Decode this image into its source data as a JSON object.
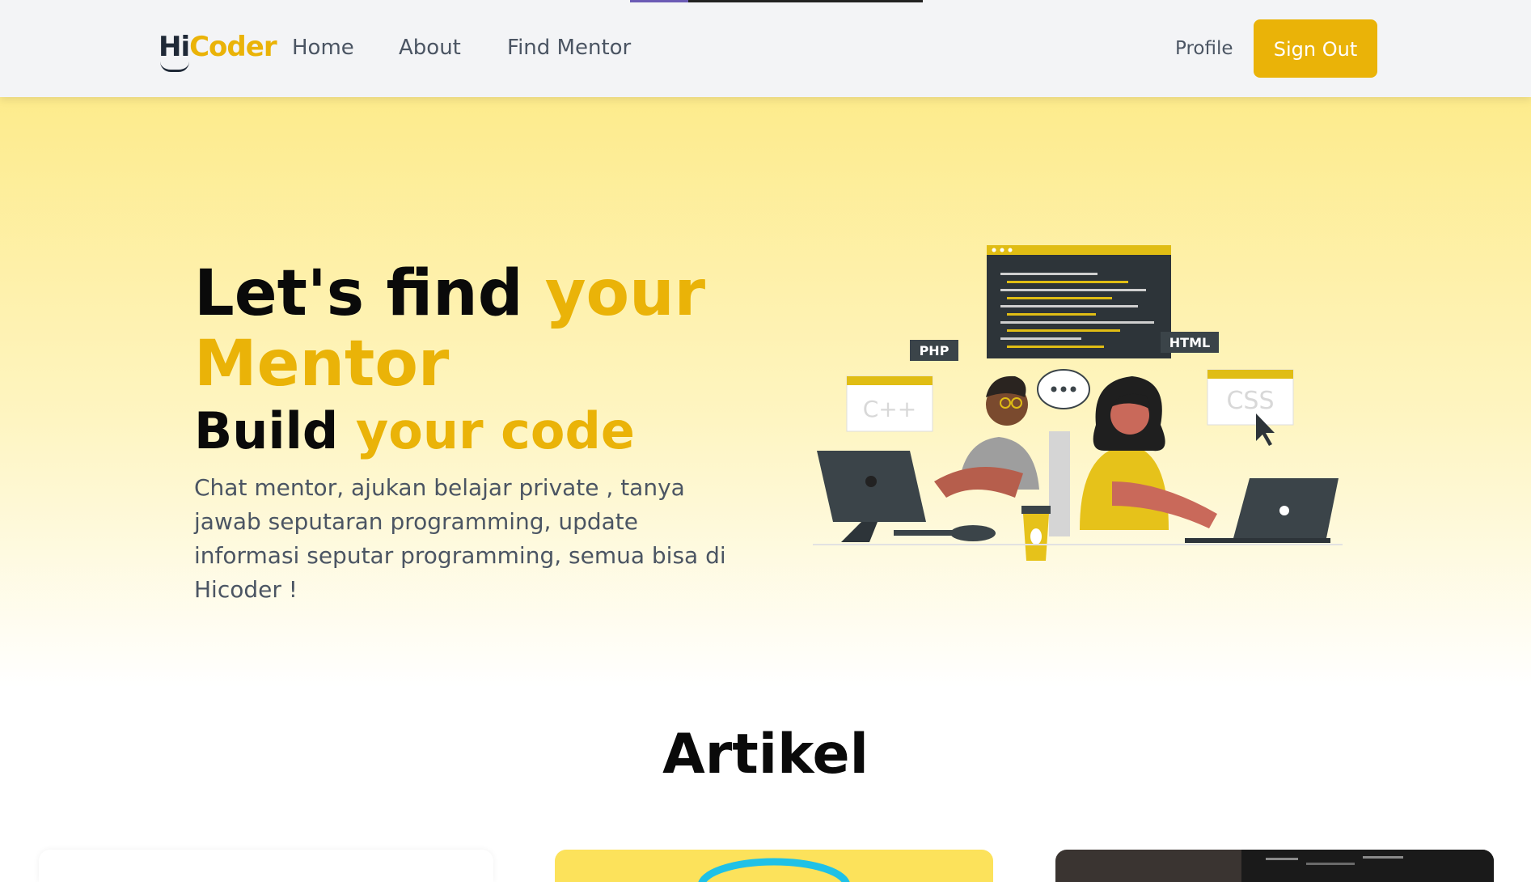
{
  "header": {
    "logo_hi": "Hi",
    "logo_coder": "Coder",
    "nav": {
      "home": "Home",
      "about": "About",
      "find_mentor": "Find Mentor"
    },
    "profile": "Profile",
    "sign_out": "Sign Out"
  },
  "hero": {
    "line1_a": "Let's find",
    "line1_b": "your",
    "line2": "Mentor",
    "line3_a": "Build",
    "line3_b": "your code",
    "description": "Chat mentor, ajukan belajar private , tanya jawab seputaran programming, update informasi seputar programming, semua bisa di Hicoder !",
    "illustration_labels": {
      "php": "PHP",
      "html": "HTML",
      "cpp": "C++",
      "css": "CSS"
    }
  },
  "section": {
    "title": "Artikel"
  },
  "colors": {
    "accent": "#eab308",
    "text_dark": "#0a0a0a",
    "text_muted": "#4b5563"
  }
}
